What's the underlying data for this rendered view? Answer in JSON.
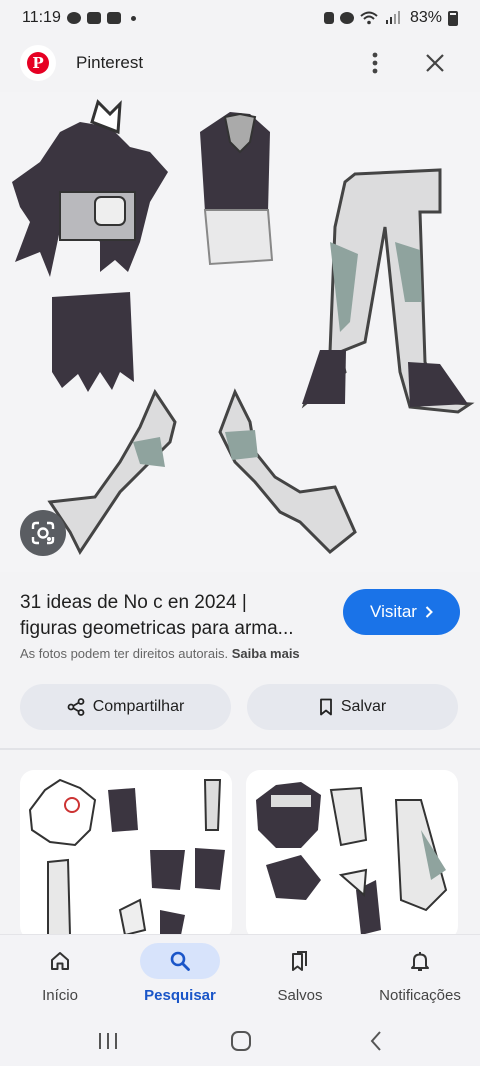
{
  "status_bar": {
    "time": "11:19",
    "battery": "83%"
  },
  "header": {
    "source": "Pinterest"
  },
  "result": {
    "title_line1": "31 ideas de No c en 2024 |",
    "title_line2": "figuras geometricas para arma...",
    "visit_label": "Visitar",
    "copyright_text": "As fotos podem ter direitos autorais.",
    "learn_more": "Saiba mais"
  },
  "actions": {
    "share_label": "Compartilhar",
    "save_label": "Salvar"
  },
  "bottom_nav": {
    "items": [
      {
        "label": "Início",
        "icon": "home-icon",
        "active": false
      },
      {
        "label": "Pesquisar",
        "icon": "search-icon",
        "active": true
      },
      {
        "label": "Salvos",
        "icon": "bookmarks-icon",
        "active": false
      },
      {
        "label": "Notificações",
        "icon": "bell-icon",
        "active": false
      }
    ]
  },
  "colors": {
    "accent": "#1a73e8",
    "pinterest": "#e60023",
    "active_nav": "#1a55c8"
  }
}
